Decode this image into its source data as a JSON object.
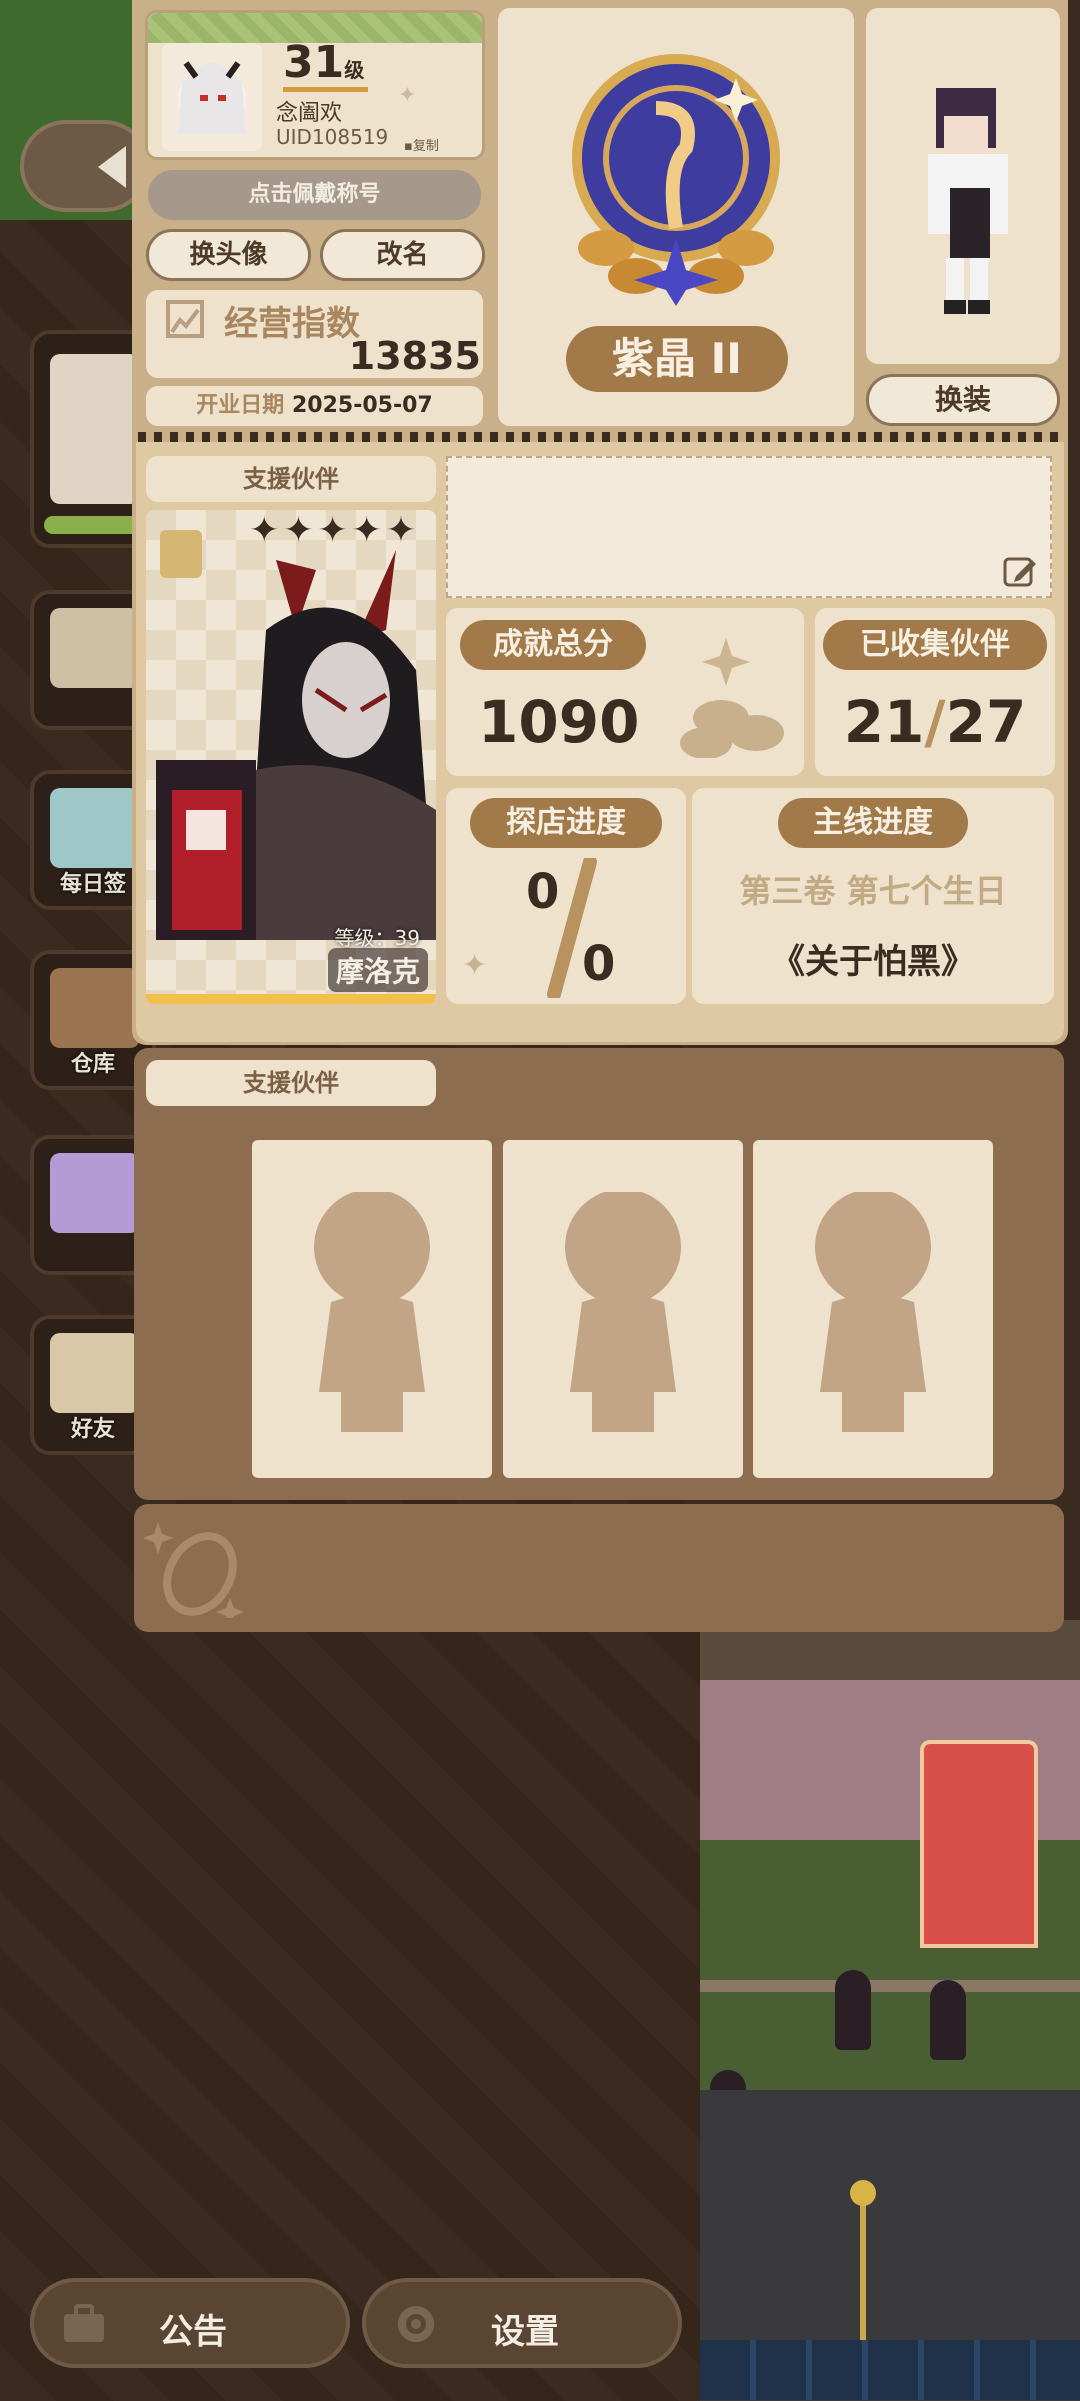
{
  "profile": {
    "level": "31",
    "level_unit": "级",
    "name": "念阖欢",
    "uid": "UID108519",
    "copy_label": "复制",
    "title_button": "点击佩戴称号",
    "change_avatar": "换头像",
    "rename": "改名",
    "business_index_label": "经营指数",
    "business_index_value": "13835",
    "open_date_label": "开业日期",
    "open_date_value": "2025-05-07"
  },
  "rank": {
    "label": "紫晶 II"
  },
  "outfit": {
    "change_label": "换装"
  },
  "support": {
    "section_label": "支援伙伴",
    "partner_level_label": "等级：39",
    "partner_name": "摩洛克",
    "stars": 5
  },
  "stats": {
    "achievement_label": "成就总分",
    "achievement_value": "1090",
    "collected_label": "已收集伙伴",
    "collected_have": "21",
    "collected_sep": "/",
    "collected_total": "27",
    "explore_label": "探店进度",
    "explore_have": "0",
    "explore_total": "0",
    "story_label": "主线进度",
    "story_chapter": "第三卷 第七个生日",
    "story_title": "《关于怕黑》"
  },
  "support2": {
    "section_label": "支援伙伴"
  },
  "sidebar": {
    "items": [
      {
        "label": ""
      },
      {
        "label": ""
      },
      {
        "label": "每日签"
      },
      {
        "label": "仓库"
      },
      {
        "label": ""
      },
      {
        "label": "好友"
      }
    ]
  },
  "bottom": {
    "notice": "公告",
    "settings": "设置"
  },
  "colors": {
    "panel": "#efe2cc",
    "accent_brown": "#a27a4a",
    "dark_brown": "#8d6d4f"
  }
}
